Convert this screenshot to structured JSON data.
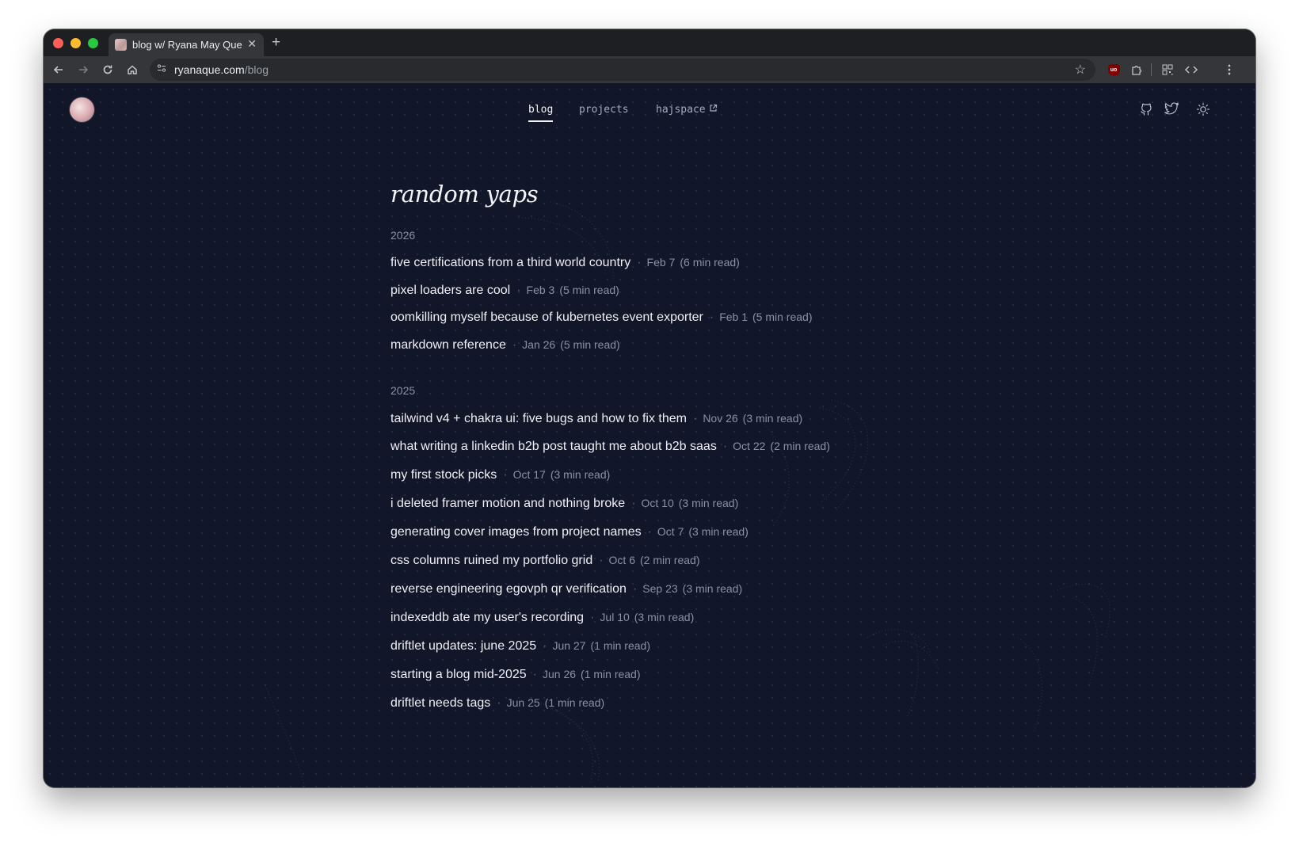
{
  "browser": {
    "tab_title": "blog w/ Ryana May Que",
    "tab_close_icon": "close-icon",
    "new_tab_icon": "plus-icon",
    "url_host": "ryanaque.com",
    "url_path": "/blog",
    "icons": [
      "back-icon",
      "forward-icon",
      "reload-icon",
      "home-icon",
      "site-info-icon",
      "bookmark-star-icon",
      "ublock-icon",
      "extensions-icon",
      "qr-code-icon",
      "devtools-icon",
      "menu-icon"
    ]
  },
  "site": {
    "nav": [
      {
        "label": "blog",
        "active": true
      },
      {
        "label": "projects",
        "active": false
      },
      {
        "label": "hajspace",
        "active": false,
        "external": true
      }
    ],
    "header_icons": [
      "github-icon",
      "twitter-icon",
      "theme-toggle-sun-icon"
    ],
    "title": "random yaps",
    "groups": [
      {
        "year": "2026",
        "posts": [
          {
            "title": "five certifications from a third world country",
            "date": "Feb 7",
            "read": "(6 min read)"
          },
          {
            "title": "pixel loaders are cool",
            "date": "Feb 3",
            "read": "(5 min read)"
          },
          {
            "title": "oomkilling myself because of kubernetes event exporter",
            "date": "Feb 1",
            "read": "(5 min read)"
          },
          {
            "title": "markdown reference",
            "date": "Jan 26",
            "read": "(5 min read)"
          }
        ]
      },
      {
        "year": "2025",
        "posts": [
          {
            "title": "tailwind v4 + chakra ui: five bugs and how to fix them",
            "date": "Nov 26",
            "read": "(3 min read)"
          },
          {
            "title": "what writing a linkedin b2b post taught me about b2b saas",
            "date": "Oct 22",
            "read": "(2 min read)"
          },
          {
            "title": "my first stock picks",
            "date": "Oct 17",
            "read": "(3 min read)"
          },
          {
            "title": "i deleted framer motion and nothing broke",
            "date": "Oct 10",
            "read": "(3 min read)"
          },
          {
            "title": "generating cover images from project names",
            "date": "Oct 7",
            "read": "(3 min read)"
          },
          {
            "title": "css columns ruined my portfolio grid",
            "date": "Oct 6",
            "read": "(2 min read)"
          },
          {
            "title": "reverse engineering egovph qr verification",
            "date": "Sep 23",
            "read": "(3 min read)"
          },
          {
            "title": "indexeddb ate my user's recording",
            "date": "Jul 10",
            "read": "(3 min read)"
          },
          {
            "title": "driftlet updates: june 2025",
            "date": "Jun 27",
            "read": "(1 min read)"
          },
          {
            "title": "starting a blog mid-2025",
            "date": "Jun 26",
            "read": "(1 min read)"
          },
          {
            "title": "driftlet needs tags",
            "date": "Jun 25",
            "read": "(1 min read)"
          }
        ]
      }
    ],
    "separator": "·"
  },
  "colors": {
    "page_background": "#111629",
    "text_primary": "#eef0f5",
    "text_muted": "#8b91a4",
    "browser_chrome": "#35363a"
  }
}
